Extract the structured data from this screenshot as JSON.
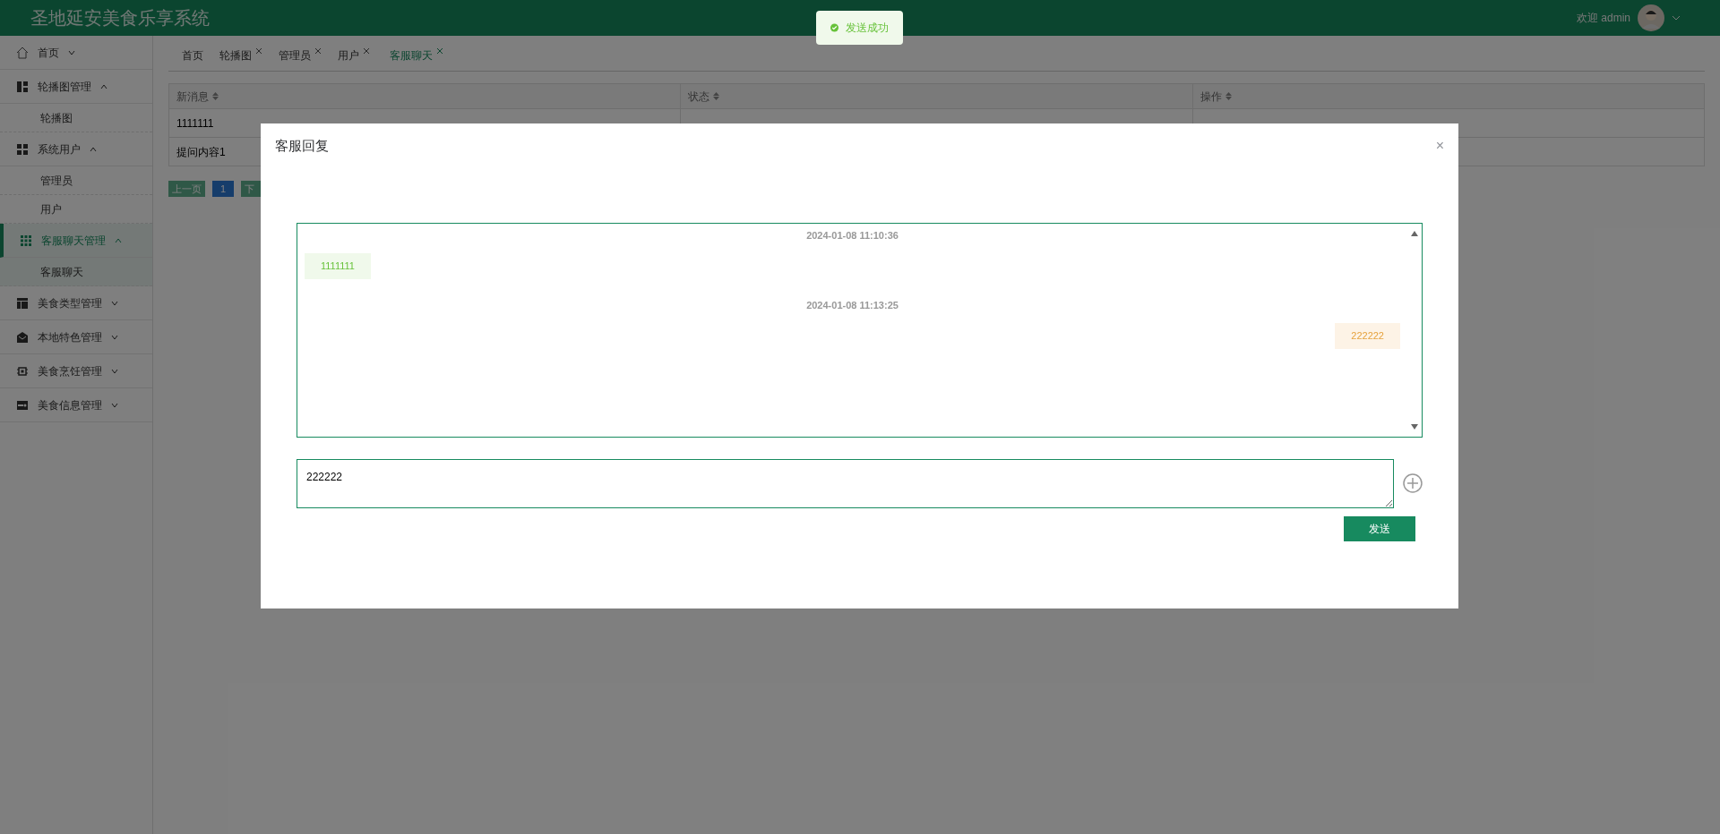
{
  "header": {
    "title": "圣地延安美食乐享系统",
    "welcome": "欢迎 admin"
  },
  "sidebar": {
    "items": [
      {
        "label": "首页",
        "expanded": false,
        "selected": false
      },
      {
        "label": "轮播图管理",
        "expanded": true,
        "selected": false,
        "children": [
          {
            "label": "轮播图",
            "selected": false
          }
        ]
      },
      {
        "label": "系统用户",
        "expanded": true,
        "selected": false,
        "children": [
          {
            "label": "管理员",
            "selected": false
          },
          {
            "label": "用户",
            "selected": false
          }
        ]
      },
      {
        "label": "客服聊天管理",
        "expanded": true,
        "selected": true,
        "children": [
          {
            "label": "客服聊天",
            "selected": true
          }
        ]
      },
      {
        "label": "美食类型管理",
        "expanded": false,
        "selected": false
      },
      {
        "label": "本地特色管理",
        "expanded": false,
        "selected": false
      },
      {
        "label": "美食烹饪管理",
        "expanded": false,
        "selected": false
      },
      {
        "label": "美食信息管理",
        "expanded": false,
        "selected": false
      }
    ]
  },
  "tabs": [
    {
      "label": "首页",
      "closable": false,
      "selected": false
    },
    {
      "label": "轮播图",
      "closable": true,
      "selected": false
    },
    {
      "label": "管理员",
      "closable": true,
      "selected": false
    },
    {
      "label": "用户",
      "closable": true,
      "selected": false
    },
    {
      "label": "客服聊天",
      "closable": true,
      "selected": true
    }
  ],
  "table": {
    "columns": [
      "新消息",
      "状态",
      "操作"
    ],
    "rows": [
      {
        "message": "1111111"
      },
      {
        "message": "提问内容1"
      }
    ]
  },
  "pagination": {
    "prev": "上一页",
    "pages": [
      {
        "label": "1",
        "selected": true
      }
    ],
    "next": "下"
  },
  "toast": {
    "text": "发送成功"
  },
  "dialog": {
    "title": "客服回复",
    "close": "×",
    "messages": [
      {
        "time": "2024-01-08 11:10:36",
        "text": "1111111",
        "kind": "received"
      },
      {
        "time": "2024-01-08 11:13:25",
        "text": "222222",
        "kind": "sent"
      }
    ],
    "input": {
      "value": "222222"
    },
    "send": "发送"
  }
}
